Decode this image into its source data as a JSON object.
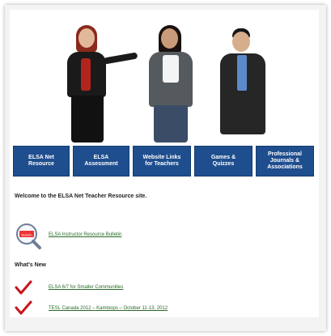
{
  "nav": {
    "buttons": [
      {
        "label": "ELSA Net\nResource"
      },
      {
        "label": "ELSA\nAssessment"
      },
      {
        "label": "Website Links\nfor Teachers"
      },
      {
        "label": "Games &\nQuizzes"
      },
      {
        "label": "Professional\nJournals &\nAssociations"
      }
    ]
  },
  "main": {
    "welcome": "Welcome to the ELSA Net Teacher Resource site.",
    "bulletin_link": "ELSA Instructor Resource Bulletin",
    "whats_new_heading": "What's New",
    "news": [
      {
        "label": "ELSA 6/7 for Smaller Communities"
      },
      {
        "label": "TESL Canada 2012 – Kamloops – October 11-13, 2012"
      }
    ]
  },
  "colors": {
    "nav_bg": "#1f4e8e",
    "link": "#2a6a2a",
    "check": "#c8141e"
  },
  "icons": {
    "bulletin": "magnifier-bulletin-icon",
    "check": "red-checkmark-icon"
  }
}
